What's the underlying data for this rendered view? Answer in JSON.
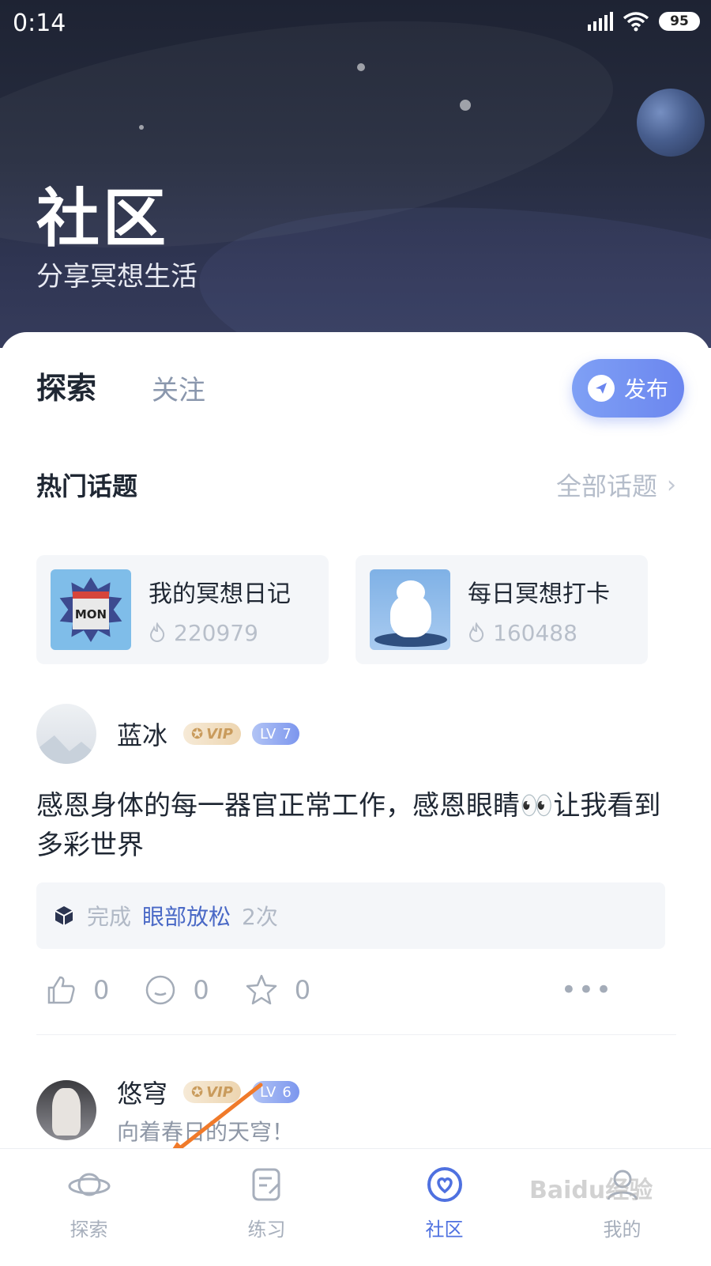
{
  "status": {
    "time": "0:14",
    "battery": "95"
  },
  "header": {
    "title": "社区",
    "subtitle": "分享冥想生活"
  },
  "tabs": [
    {
      "label": "探索"
    },
    {
      "label": "关注"
    }
  ],
  "publish_label": "发布",
  "hot_topics": {
    "title": "热门话题",
    "all_label": "全部话题",
    "items": [
      {
        "name": "我的冥想日记",
        "count": "220979",
        "thumb_text": "MON"
      },
      {
        "name": "每日冥想打卡",
        "count": "160488"
      }
    ]
  },
  "posts": [
    {
      "user": "蓝冰",
      "vip": "VIP",
      "level": "7",
      "text": "感恩身体的每一器官正常工作，感恩眼睛👀让我看到多彩世界",
      "record": {
        "prefix": "完成",
        "item": "眼部放松",
        "count": "2次"
      },
      "likes": "0",
      "comments": "0",
      "favorites": "0",
      "more": "•••"
    },
    {
      "user": "悠穹",
      "vip": "VIP",
      "level": "6",
      "subtitle": "向着春日的天穹！"
    }
  ],
  "bottom_nav": [
    {
      "label": "探索",
      "icon": "planet-icon"
    },
    {
      "label": "练习",
      "icon": "practice-icon"
    },
    {
      "label": "社区",
      "icon": "community-icon",
      "active": true
    },
    {
      "label": "我的",
      "icon": "profile-icon"
    }
  ],
  "watermark": "Baidu经验",
  "colors": {
    "accent": "#4f71e0",
    "publish": "#6b86ef",
    "vip": "#c99b5c",
    "annotation_arrow": "#f07a2a"
  }
}
